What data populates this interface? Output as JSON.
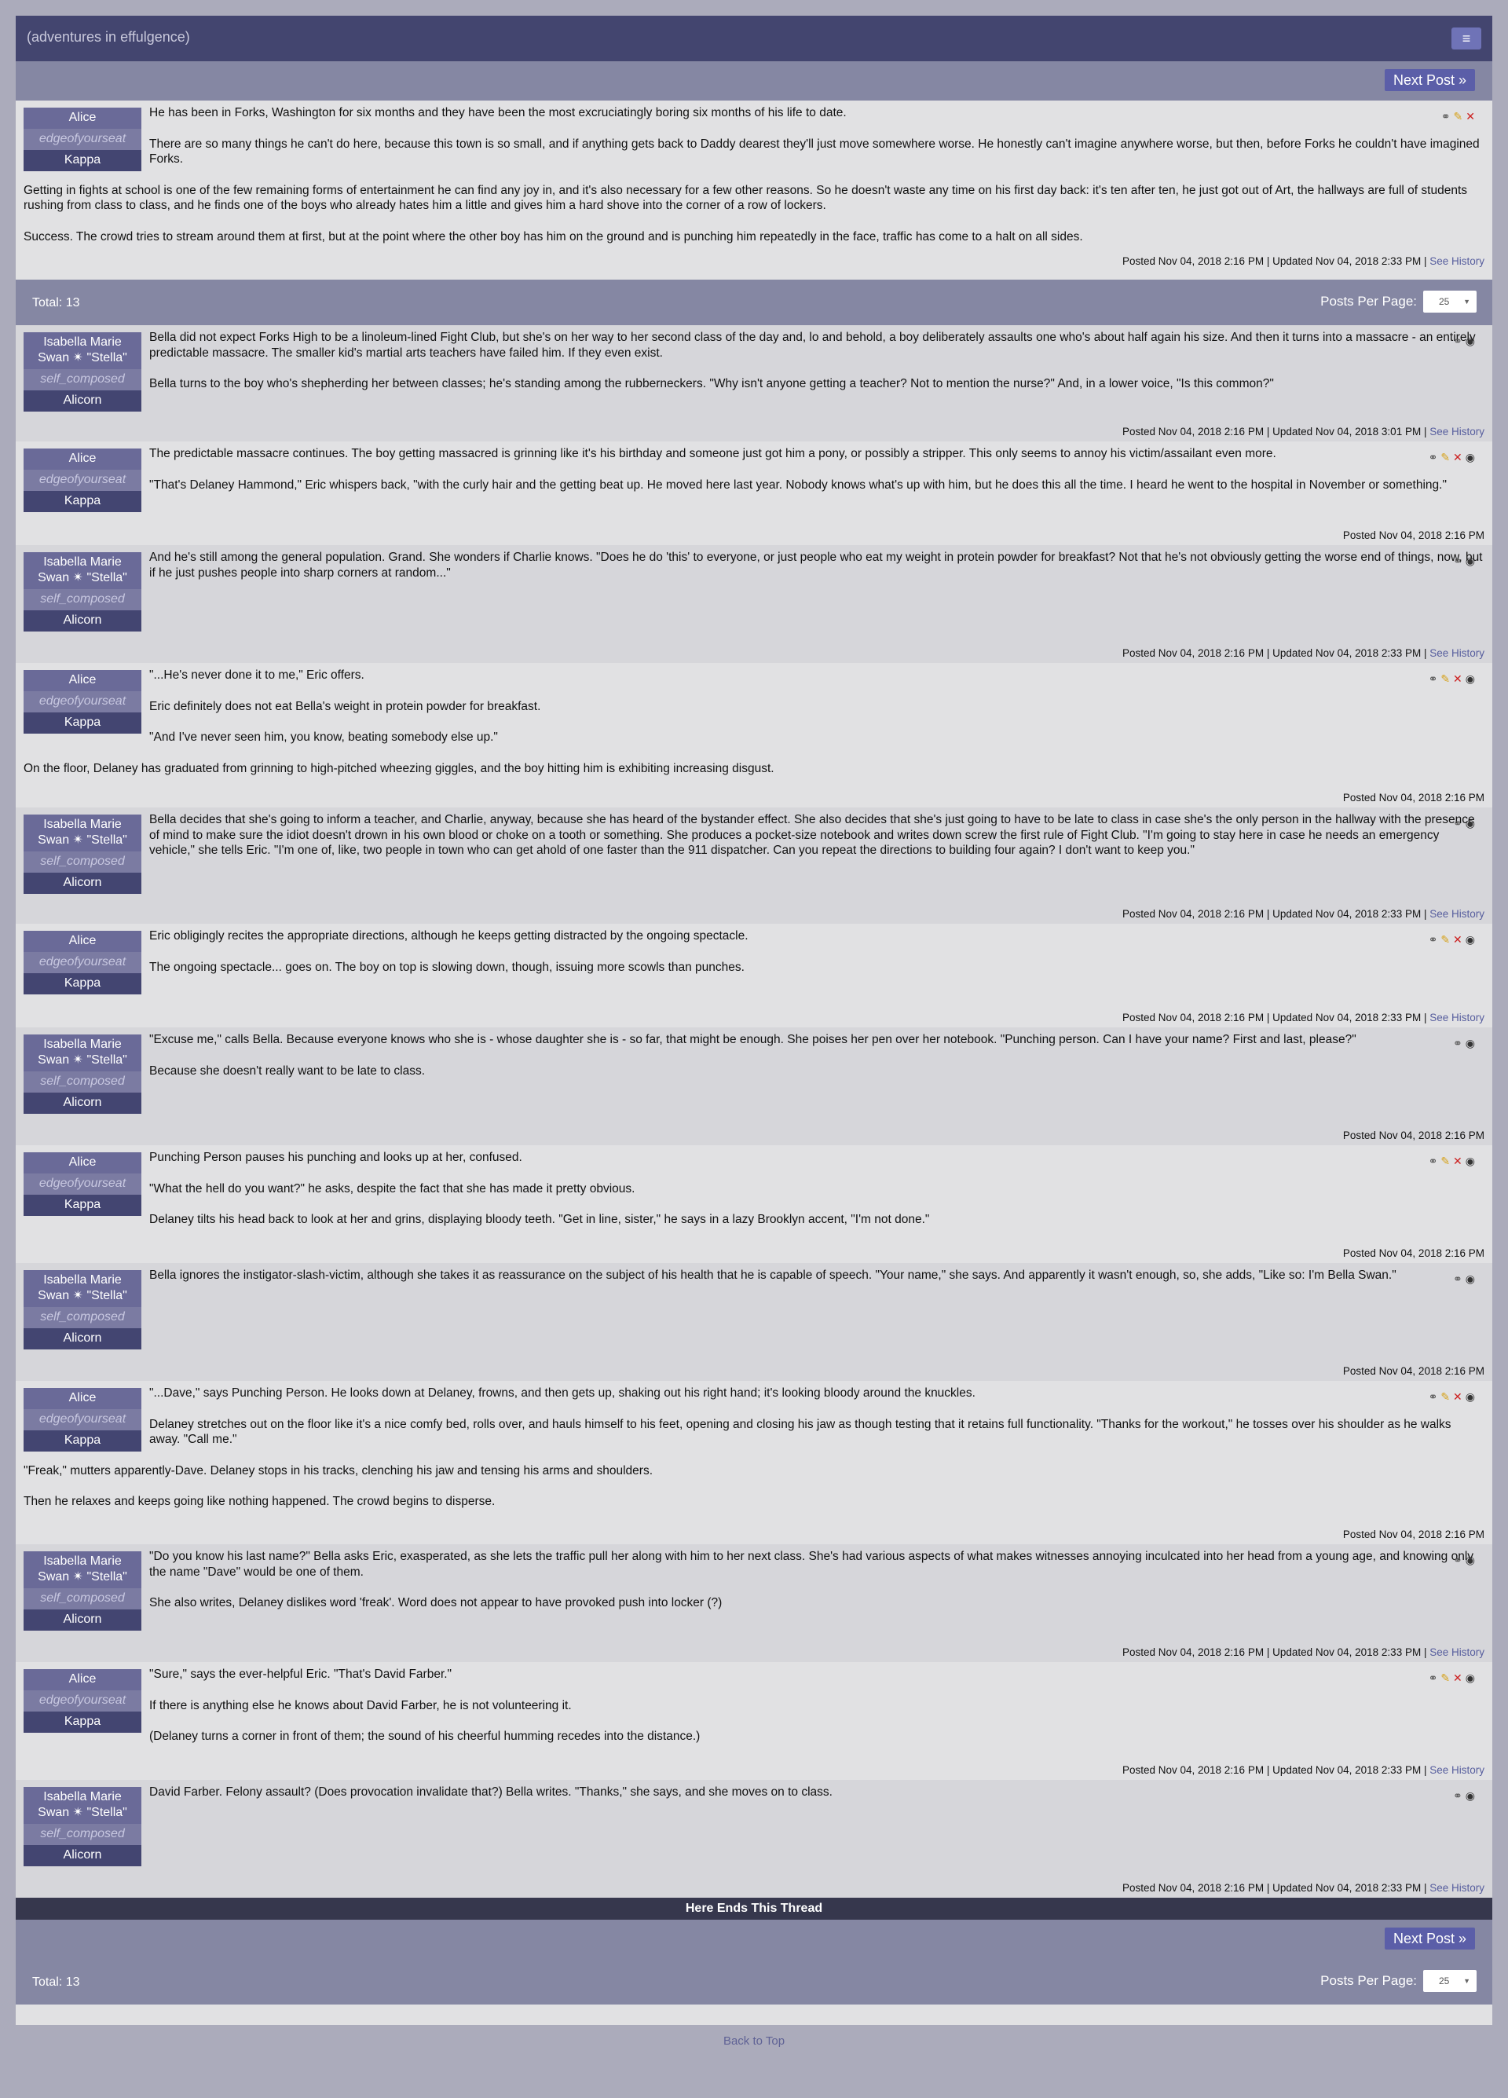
{
  "site": {
    "title": "(adventures in effulgence)",
    "menu_icon": "hamburger-icon",
    "back_to_top": "Back to Top"
  },
  "nav": {
    "next_post": "Next Post »",
    "total": "Total: 13",
    "posts_per_page_label": "Posts Per Page:",
    "posts_per_page_value": "25",
    "ends_thread": "Here Ends This Thread"
  },
  "colors": {
    "header": "#43456f",
    "nav": "#8587a3",
    "accent": "#5b5ea8",
    "alice_char": "#6a6a98",
    "board": "#434571",
    "delete": "#cc1f1f",
    "edit": "#d6a21a"
  },
  "first_post": {
    "character": "Alice",
    "screenname": "edgeofyourseat",
    "board": "Kappa",
    "paragraphs": [
      "He has been in Forks, Washington for six months and they have been the most excruciatingly boring six months of his life to date.",
      "There are so many things he can't do here, because this town is so small, and if anything gets back to Daddy dearest they'll just move somewhere worse. He honestly can't imagine anywhere worse, but then, before Forks he couldn't have imagined Forks.",
      "Getting in fights at school is one of the few remaining forms of entertainment he can find any joy in, and it's also necessary for a few other reasons. So he doesn't waste any time on his first day back: it's ten after ten, he just got out of Art, the hallways are full of students rushing from class to class, and he finds one of the boys who already hates him a little and gives him a hard shove into the corner of a row of lockers.",
      "Success. The crowd tries to stream around them at first, but at the point where the other boy has him on the ground and is punching him repeatedly in the face, traffic has come to a halt on all sides."
    ],
    "footer": "Posted Nov 04, 2018 2:16 PM | Updated Nov 04, 2018 2:33 PM | ",
    "history": "See History"
  },
  "replies": [
    {
      "who": "bella",
      "paragraphs": [
        "Bella did not expect Forks High to be a linoleum-lined Fight Club, but she's on her way to her second class of the day and, lo and behold, a boy deliberately assaults one who's about half again his size. And then it turns into a massacre - an entirely predictable massacre. The smaller kid's martial arts teachers have failed him. If they even exist.",
        "Bella turns to the boy who's shepherding her between classes; he's standing among the rubberneckers. \"Why isn't anyone getting a teacher? Not to mention the nurse?\" And, in a lower voice, \"Is this common?\""
      ],
      "footer": "Posted Nov 04, 2018 2:16 PM | Updated Nov 04, 2018 3:01 PM | ",
      "history": "See History"
    },
    {
      "who": "alice",
      "paragraphs": [
        "The predictable massacre continues. The boy getting massacred is grinning like it's his birthday and someone just got him a pony, or possibly a stripper. This only seems to annoy his victim/assailant even more.",
        "\"That's Delaney Hammond,\" Eric whispers back, \"with the curly hair and the getting beat up. He moved here last year. Nobody knows what's up with him, but he does this all the time. I heard he went to the hospital in November or something.\""
      ],
      "footer": "Posted Nov 04, 2018 2:16 PM",
      "history": ""
    },
    {
      "who": "bella",
      "paragraphs": [
        "And he's still among the general population. Grand. She wonders if Charlie knows. \"Does he do 'this' to everyone, or just people who eat my weight in protein powder for breakfast? Not that he's not obviously getting the worse end of things, now, but if he just pushes people into sharp corners at random...\""
      ],
      "footer": "Posted Nov 04, 2018 2:16 PM | Updated Nov 04, 2018 2:33 PM | ",
      "history": "See History"
    },
    {
      "who": "alice",
      "paragraphs": [
        "\"...He's never done it to me,\" Eric offers.",
        "Eric definitely does not eat Bella's weight in protein powder for breakfast.",
        "\"And I've never seen him, you know, beating somebody else up.\"",
        "On the floor, Delaney has graduated from grinning to high-pitched wheezing giggles, and the boy hitting him is exhibiting increasing disgust."
      ],
      "footer": "Posted Nov 04, 2018 2:16 PM",
      "history": ""
    },
    {
      "who": "bella",
      "paragraphs": [
        "Bella decides that she's going to inform a teacher, and Charlie, anyway, because she has heard of the bystander effect. She also decides that she's just going to have to be late to class in case she's the only person in the hallway with the presence of mind to make sure the idiot doesn't drown in his own blood or choke on a tooth or something. She produces a pocket-size notebook and writes down screw the first rule of Fight Club. \"I'm going to stay here in case he needs an emergency vehicle,\" she tells Eric. \"I'm one of, like, two people in town who can get ahold of one faster than the 911 dispatcher. Can you repeat the directions to building four again? I don't want to keep you.\""
      ],
      "footer": "Posted Nov 04, 2018 2:16 PM | Updated Nov 04, 2018 2:33 PM | ",
      "history": "See History"
    },
    {
      "who": "alice",
      "paragraphs": [
        "Eric obligingly recites the appropriate directions, although he keeps getting distracted by the ongoing spectacle.",
        "The ongoing spectacle... goes on. The boy on top is slowing down, though, issuing more scowls than punches."
      ],
      "footer": "Posted Nov 04, 2018 2:16 PM | Updated Nov 04, 2018 2:33 PM | ",
      "history": "See History"
    },
    {
      "who": "bella",
      "paragraphs": [
        "\"Excuse me,\" calls Bella. Because everyone knows who she is - whose daughter she is - so far, that might be enough. She poises her pen over her notebook. \"Punching person. Can I have your name? First and last, please?\"",
        "Because she doesn't really want to be late to class."
      ],
      "footer": "Posted Nov 04, 2018 2:16 PM",
      "history": ""
    },
    {
      "who": "alice",
      "paragraphs": [
        "Punching Person pauses his punching and looks up at her, confused.",
        "\"What the hell do you want?\" he asks, despite the fact that she has made it pretty obvious.",
        "Delaney tilts his head back to look at her and grins, displaying bloody teeth. \"Get in line, sister,\" he says in a lazy Brooklyn accent, \"I'm not done.\""
      ],
      "footer": "Posted Nov 04, 2018 2:16 PM",
      "history": ""
    },
    {
      "who": "bella",
      "paragraphs": [
        "Bella ignores the instigator-slash-victim, although she takes it as reassurance on the subject of his health that he is capable of speech. \"Your name,\" she says. And apparently it wasn't enough, so, she adds, \"Like so: I'm Bella Swan.\""
      ],
      "footer": "Posted Nov 04, 2018 2:16 PM",
      "history": ""
    },
    {
      "who": "alice",
      "paragraphs": [
        "\"...Dave,\" says Punching Person. He looks down at Delaney, frowns, and then gets up, shaking out his right hand; it's looking bloody around the knuckles.",
        "Delaney stretches out on the floor like it's a nice comfy bed, rolls over, and hauls himself to his feet, opening and closing his jaw as though testing that it retains full functionality. \"Thanks for the workout,\" he tosses over his shoulder as he walks away. \"Call me.\"",
        "\"Freak,\" mutters apparently-Dave. Delaney stops in his tracks, clenching his jaw and tensing his arms and shoulders.",
        "Then he relaxes and keeps going like nothing happened. The crowd begins to disperse."
      ],
      "footer": "Posted Nov 04, 2018 2:16 PM",
      "history": ""
    },
    {
      "who": "bella",
      "paragraphs": [
        "\"Do you know his last name?\" Bella asks Eric, exasperated, as she lets the traffic pull her along with him to her next class. She's had various aspects of what makes witnesses annoying inculcated into her head from a young age, and knowing only the name \"Dave\" would be one of them.",
        "She also writes, Delaney dislikes word 'freak'. Word does not appear to have provoked push into locker (?)"
      ],
      "footer": "Posted Nov 04, 2018 2:16 PM | Updated Nov 04, 2018 2:33 PM | ",
      "history": "See History"
    },
    {
      "who": "alice",
      "paragraphs": [
        "\"Sure,\" says the ever-helpful Eric. \"That's David Farber.\"",
        "If there is anything else he knows about David Farber, he is not volunteering it.",
        "(Delaney turns a corner in front of them; the sound of his cheerful humming recedes into the distance.)"
      ],
      "footer": "Posted Nov 04, 2018 2:16 PM | Updated Nov 04, 2018 2:33 PM | ",
      "history": "See History"
    },
    {
      "who": "bella",
      "paragraphs": [
        "David Farber. Felony assault? (Does provocation invalidate that?) Bella writes. \"Thanks,\" she says, and she moves on to class."
      ],
      "footer": "Posted Nov 04, 2018 2:16 PM | Updated Nov 04, 2018 2:33 PM | ",
      "history": "See History"
    }
  ],
  "authors": {
    "alice": {
      "character": "Alice",
      "screenname": "edgeofyourseat",
      "board": "Kappa",
      "icons": [
        "link-icon",
        "edit-icon",
        "delete-icon",
        "eye-icon"
      ]
    },
    "bella": {
      "character": "Isabella Marie Swan ✴ \"Stella\"",
      "screenname": "self_composed",
      "board": "Alicorn",
      "icons": [
        "link-icon",
        "eye-icon"
      ]
    }
  }
}
